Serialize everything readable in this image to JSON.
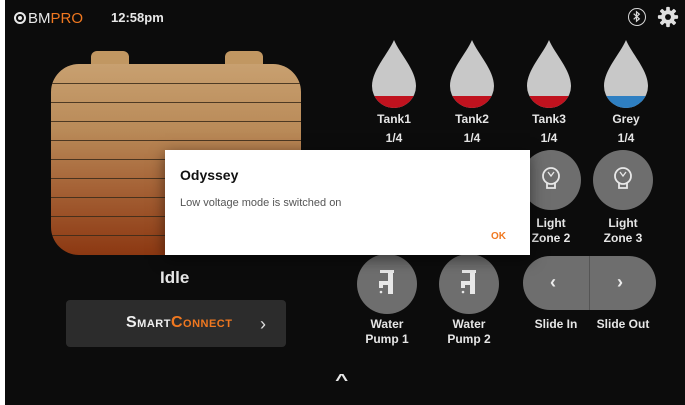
{
  "header": {
    "brand_prefix": "BM",
    "brand_suffix": "PRO",
    "time": "12:58pm",
    "icons": [
      "bluetooth-icon",
      "gear-icon"
    ]
  },
  "battery": {
    "status": "Idle"
  },
  "smartconnect": {
    "label_part1": "Smart",
    "label_part2": "Connect",
    "chevron": "›"
  },
  "tanks": [
    {
      "name": "Tank1",
      "level": "1/4",
      "fill_color": "#c0121e"
    },
    {
      "name": "Tank2",
      "level": "1/4",
      "fill_color": "#c0121e"
    },
    {
      "name": "Tank3",
      "level": "1/4",
      "fill_color": "#c0121e"
    },
    {
      "name": "Grey",
      "level": "1/4",
      "fill_color": "#2e7fc2"
    }
  ],
  "lights": [
    {
      "label_line1": "Light",
      "label_line2": "Zone 2"
    },
    {
      "label_line1": "Light",
      "label_line2": "Zone 3"
    }
  ],
  "pumps": [
    {
      "label_line1": "Water",
      "label_line2": "Pump 1"
    },
    {
      "label_line1": "Water",
      "label_line2": "Pump 2"
    }
  ],
  "slide": {
    "in_label": "Slide In",
    "out_label": "Slide Out",
    "left_arrow": "‹",
    "right_arrow": "›"
  },
  "footer": {
    "caret": "^"
  },
  "dialog": {
    "title": "Odyssey",
    "message": "Low voltage mode is switched on",
    "ok_label": "OK"
  },
  "colors": {
    "accent": "#f07820",
    "button_gray": "#6e6e6e",
    "background": "#0c0c0c"
  }
}
